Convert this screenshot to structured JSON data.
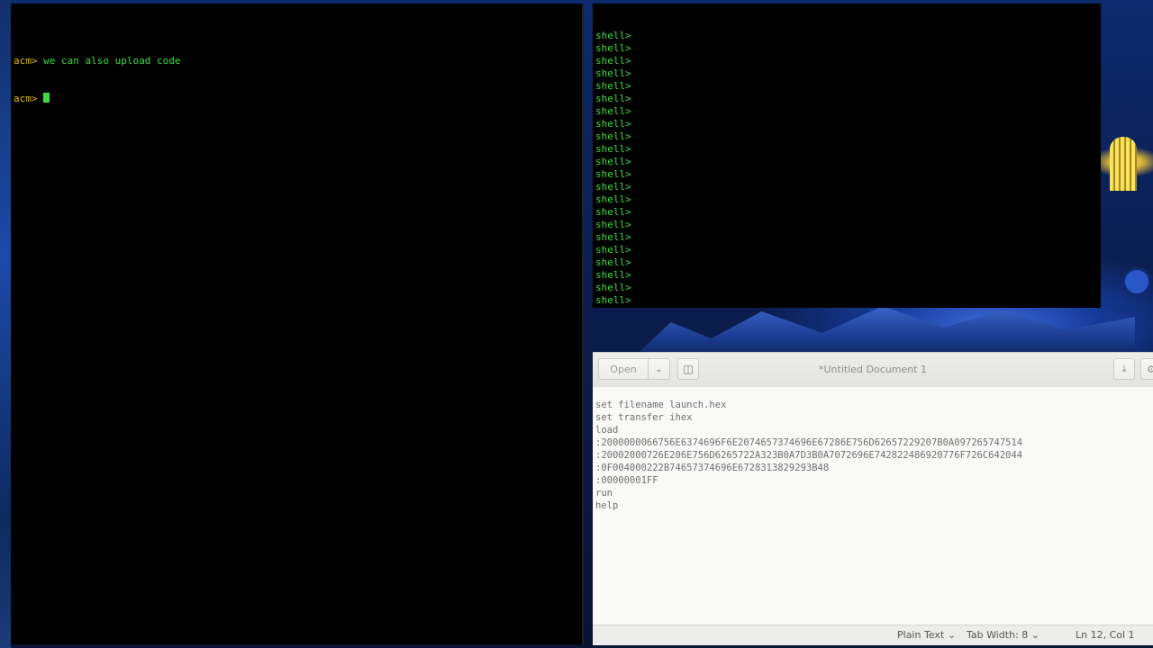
{
  "left_terminal": {
    "lines": [
      {
        "prompt": "acm>",
        "text": " we can also upload code"
      },
      {
        "prompt": "acm>",
        "text": " "
      }
    ]
  },
  "right_terminal": {
    "prompt": "shell>",
    "line_count": 24
  },
  "editor": {
    "title": "*Untitled Document 1",
    "open_label": "Open",
    "open_menu_icon": "chevron-down-icon",
    "new_tab_icon": "new-tab-icon",
    "save_icon": "save-icon",
    "gear_icon": "gear-icon",
    "content_lines": [
      "set filename launch.hex",
      "set transfer ihex",
      "load",
      ":2000000066756E6374696F6E2074657374696E67286E756D62657229207B0A097265747514",
      ":20002000726E206E756D6265722A323B0A7D3B0A7072696E742822486920776F726C642044",
      ":0F004000222B74657374696E6728313829293B48",
      ":00000001FF",
      "run",
      "help"
    ],
    "status": {
      "language": "Plain Text",
      "tab_width": "Tab Width: 8",
      "position": "Ln 12, Col 1"
    }
  }
}
